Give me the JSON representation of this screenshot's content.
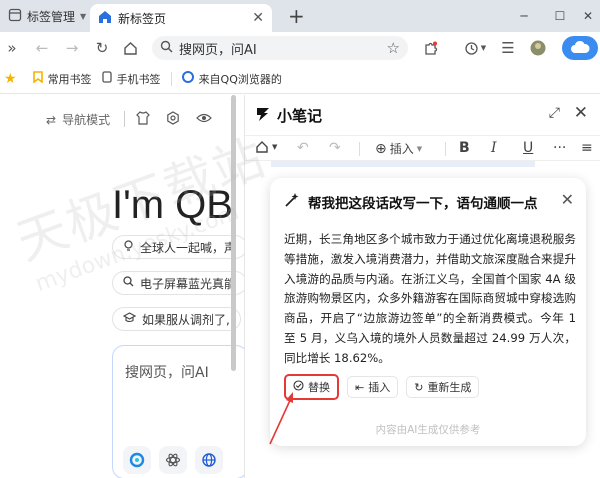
{
  "tabs": {
    "manager_label": "标签管理",
    "active_label": "新标签页"
  },
  "toolbar": {
    "address_text": "搜网页，问AI"
  },
  "bookmarks": [
    {
      "label": "常用书签"
    },
    {
      "label": "手机书签"
    },
    {
      "label": "来自QQ浏览器的"
    }
  ],
  "left": {
    "nav_mode": "导航模式",
    "hero": "I'm QB",
    "suggestions": [
      "全球人一起喊，声",
      "电子屏幕蓝光真能",
      "如果服从调剂了,"
    ],
    "search_placeholder": "搜网页，问AI"
  },
  "panel": {
    "title": "小笔记",
    "insert_label": "插入"
  },
  "card": {
    "title": "帮我把这段话改写一下，语句通顺一点",
    "body": "近期，长三角地区多个城市致力于通过优化离境退税服务等措施，激发入境消费潜力，并借助文旅深度融合来提升入境游的品质与内涵。在浙江义乌，全国首个国家 4A 级旅游购物景区内，众多外籍游客在国际商贸城中穿梭选购商品，开启了“边旅游边签单”的全新消费模式。今年 1 至 5 月，义乌入境的境外人员数量超过 24.99 万人次，同比增长 18.62%。",
    "actions": {
      "replace": "替换",
      "insert": "插入",
      "regenerate": "重新生成"
    },
    "disclaimer": "内容由AI生成仅供参考"
  },
  "watermark": {
    "main": "天极下载站",
    "sub": "mydown.yesky.com"
  },
  "colors": {
    "accent": "#3b8cf0",
    "highlight": "#e53935",
    "bookmark_star": "#f5b400"
  }
}
